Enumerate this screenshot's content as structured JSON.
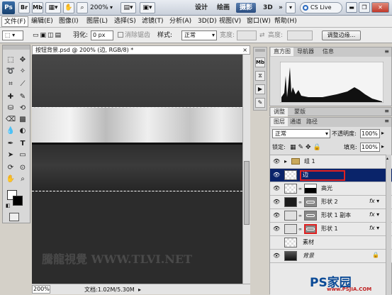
{
  "app": {
    "logo": "Ps",
    "zoom": "200%"
  },
  "workspaces": [
    "设计",
    "绘画",
    "摄影",
    "3D"
  ],
  "cs_live": "CS Live",
  "menus": [
    "文件(F)",
    "编辑(E)",
    "图像(I)",
    "图层(L)",
    "选择(S)",
    "滤镜(T)",
    "分析(A)",
    "3D(D)",
    "视图(V)",
    "窗口(W)",
    "帮助(H)"
  ],
  "options": {
    "feather_label": "羽化:",
    "feather_value": "0 px",
    "antialias_label": "消除锯齿",
    "style_label": "样式:",
    "style_value": "正常",
    "width_label": "宽度:",
    "height_label": "高度:",
    "refine_button": "调整边缘..."
  },
  "document": {
    "tab_title": "按钮背景.psd @ 200% (边, RGB/8) *",
    "status_zoom": "200%",
    "status_doc": "文档:1.02M/5.30M",
    "watermark": "騰龍視覺 WWW.TLVI.NET"
  },
  "panels": {
    "top_tabs": [
      "直方图",
      "导航器",
      "信息"
    ],
    "adj_tabs": [
      "调整",
      "蒙版"
    ],
    "layer_tabs": [
      "图层",
      "通道",
      "路径"
    ],
    "blend_mode": "正常",
    "opacity_label": "不透明度:",
    "opacity_value": "100%",
    "lock_label": "锁定:",
    "fill_label": "填充:",
    "fill_value": "100%"
  },
  "layers": [
    {
      "name": "组 1",
      "kind": "group"
    },
    {
      "name": "边",
      "kind": "selected"
    },
    {
      "name": "高光",
      "kind": "mask"
    },
    {
      "name": "形状 2",
      "kind": "shape"
    },
    {
      "name": "形状 1 副本",
      "kind": "shape"
    },
    {
      "name": "形状 1",
      "kind": "shape"
    },
    {
      "name": "素材",
      "kind": "plain"
    },
    {
      "name": "背景",
      "kind": "bg"
    }
  ],
  "corner_watermark": "PS家园",
  "corner_url": "www.PSJIA.COM"
}
